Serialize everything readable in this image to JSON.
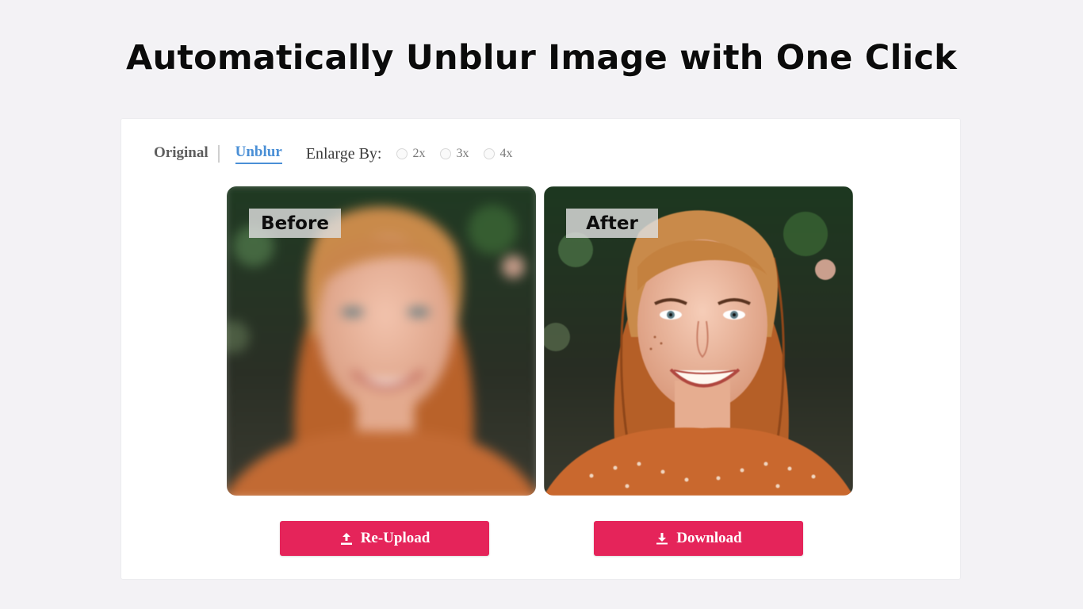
{
  "headline": "Automatically Unblur Image with One Click",
  "tabs": {
    "original": "Original",
    "unblur": "Unblur"
  },
  "enlarge": {
    "label": "Enlarge By:",
    "options": [
      "2x",
      "3x",
      "4x"
    ]
  },
  "images": {
    "before_label": "Before",
    "after_label": "After"
  },
  "buttons": {
    "reupload": "Re-Upload",
    "download": "Download"
  },
  "icons": {
    "reupload": "upload-icon",
    "download": "download-icon"
  },
  "colors": {
    "accent_button": "#e5245a",
    "active_tab": "#4a8fd6",
    "background": "#f3f2f5"
  }
}
